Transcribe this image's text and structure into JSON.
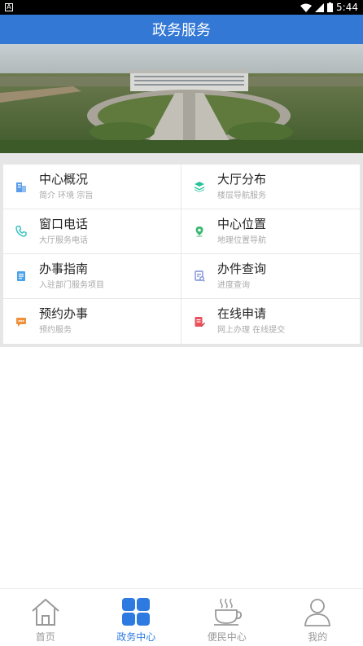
{
  "status_bar": {
    "time": "5:44"
  },
  "header": {
    "title": "政务服务"
  },
  "grid": [
    {
      "title": "中心概况",
      "subtitle": "简介 环境 宗旨",
      "icon": "building-icon",
      "color": "#5b9de8"
    },
    {
      "title": "大厅分布",
      "subtitle": "楼层导航服务",
      "icon": "layers-icon",
      "color": "#27c29a"
    },
    {
      "title": "窗口电话",
      "subtitle": "大厅服务电话",
      "icon": "phone-icon",
      "color": "#33c1c1"
    },
    {
      "title": "中心位置",
      "subtitle": "地理位置导航",
      "icon": "location-icon",
      "color": "#3bb870"
    },
    {
      "title": "办事指南",
      "subtitle": "入驻部门服务项目",
      "icon": "document-icon",
      "color": "#4aa3e8"
    },
    {
      "title": "办件查询",
      "subtitle": "进度查询",
      "icon": "search-doc-icon",
      "color": "#7a8fd8"
    },
    {
      "title": "预约办事",
      "subtitle": "预约服务",
      "icon": "chat-icon",
      "color": "#f0903a"
    },
    {
      "title": "在线申请",
      "subtitle": "网上办理 在线提交",
      "icon": "edit-doc-icon",
      "color": "#e8505b"
    }
  ],
  "tabbar": {
    "items": [
      {
        "label": "首页",
        "icon": "home-icon",
        "active": false
      },
      {
        "label": "政务中心",
        "icon": "grid-icon",
        "active": true
      },
      {
        "label": "便民中心",
        "icon": "cup-icon",
        "active": false
      },
      {
        "label": "我的",
        "icon": "user-icon",
        "active": false
      }
    ]
  },
  "colors": {
    "primary": "#3478d6",
    "active_tab": "#2d7be0"
  }
}
